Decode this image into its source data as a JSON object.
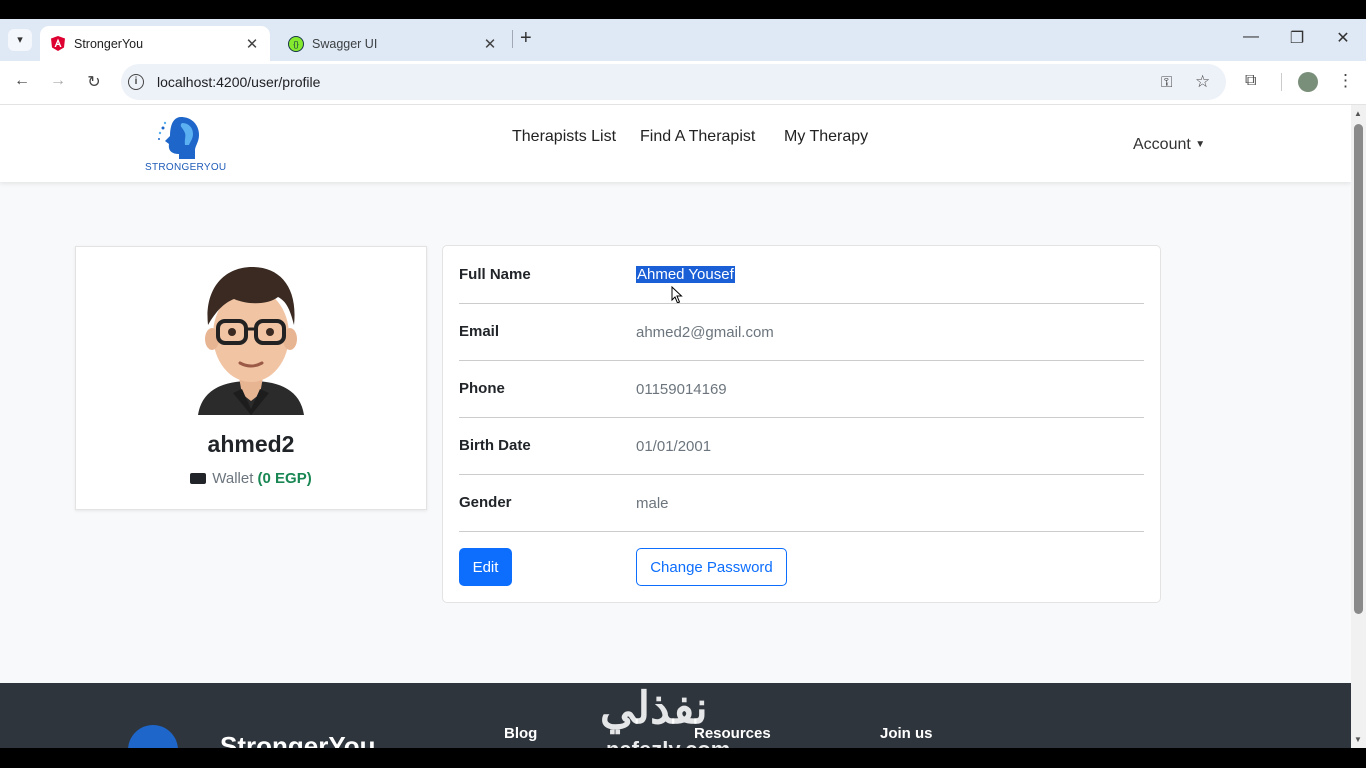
{
  "browser": {
    "tabs": [
      {
        "title": "StrongerYou",
        "active": true
      },
      {
        "title": "Swagger UI",
        "active": false
      }
    ],
    "new_tab": "+",
    "url": "localhost:4200/user/profile"
  },
  "site": {
    "logo_text": "STRONGERYOU",
    "nav": [
      "Therapists List",
      "Find A Therapist",
      "My Therapy"
    ],
    "account": "Account"
  },
  "profile": {
    "username": "ahmed2",
    "wallet_label": "Wallet",
    "wallet_amount": "(0 EGP)"
  },
  "details": {
    "full_name_label": "Full Name",
    "full_name": "Ahmed Yousef",
    "email_label": "Email",
    "email": "ahmed2@gmail.com",
    "phone_label": "Phone",
    "phone": "01159014169",
    "birth_label": "Birth Date",
    "birth": "01/01/2001",
    "gender_label": "Gender",
    "gender": "male"
  },
  "actions": {
    "edit": "Edit",
    "change_password": "Change Password"
  },
  "footer": {
    "brand": "StrongerYou",
    "columns": [
      "Blog",
      "Resources",
      "Join us"
    ]
  },
  "watermark": {
    "arabic": "نفذلي",
    "latin": "nafezly.com"
  },
  "colors": {
    "primary": "#0d6efd",
    "wallet_green": "#198754",
    "footer_bg": "#2f353d",
    "selection": "#1a5fd6"
  }
}
